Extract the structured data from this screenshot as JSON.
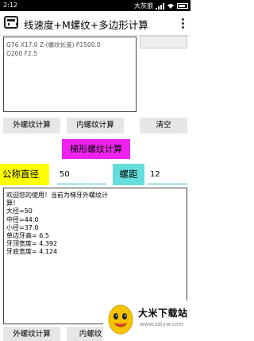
{
  "status_bar": {
    "time": "2:12",
    "carrier": "大灰狼",
    "icons": [
      "signal-icon",
      "wifi-icon",
      "battery-icon"
    ]
  },
  "app_bar": {
    "title": "线速度+M螺纹+多边形计算",
    "icons": [
      "calculator-app-icon",
      "overflow-menu-icon"
    ]
  },
  "output": {
    "lines": [
      "G76 X17.0 Z-(螺纹长度) P1500.0",
      "Q200 F2.5"
    ]
  },
  "buttons": {
    "external": "外螺纹计算",
    "internal": "内螺纹计算",
    "clear": "清空"
  },
  "trapezoid": {
    "title": "梯形螺纹计算",
    "diameter_label": "公称直径",
    "diameter_value": "50",
    "pitch_label": "螺距",
    "pitch_value": "12"
  },
  "result": {
    "lines": [
      "欢迎您的使用！当前为梯牙外螺纹计",
      "算！",
      "大径=50",
      "中径=44.0",
      "小径=37.0",
      "单边牙高= 6.5",
      "牙顶宽度= 4.392",
      "牙底宽度= 4.124"
    ]
  },
  "bottom_buttons": {
    "external": "外螺纹计算",
    "internal": "内螺纹"
  },
  "watermark": {
    "title": "大米下载站",
    "url": "www.zdiyw.com"
  },
  "colors": {
    "title_bg": "#ee22ee",
    "diameter_label_bg": "#ffff00",
    "pitch_label_bg": "#66dddd",
    "input_underline": "#33bbcc",
    "button_bg": "#e6e6e6"
  }
}
